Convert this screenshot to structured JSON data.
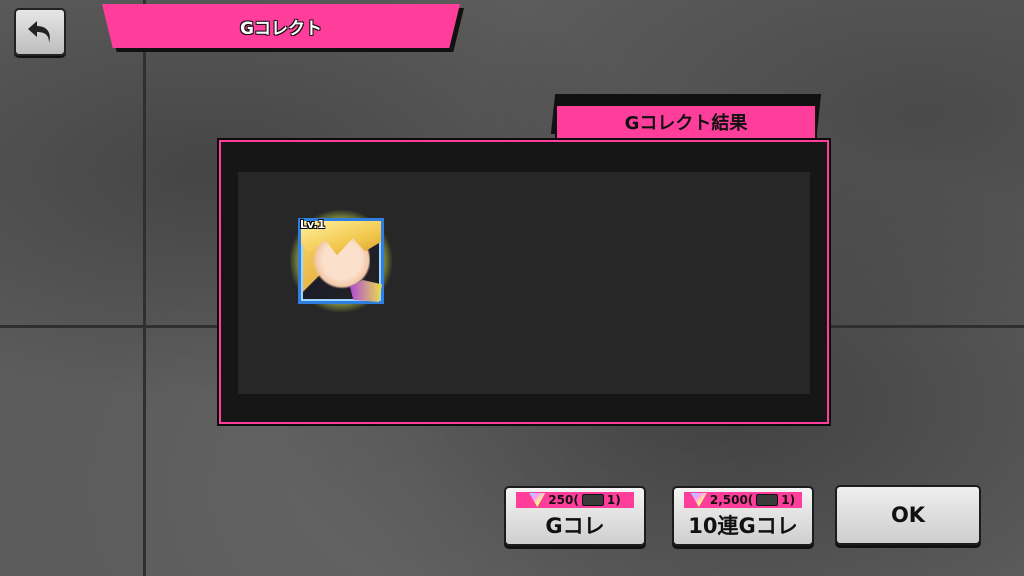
{
  "header": {
    "title": "Gコレクト"
  },
  "result": {
    "tab_label": "Gコレクト結果",
    "cards": [
      {
        "level": "Lv.1"
      }
    ]
  },
  "actions": {
    "single": {
      "cost": "250(",
      "ticket": "1)",
      "label": "Gコレ"
    },
    "ten": {
      "cost": "2,500(",
      "ticket": "1)",
      "label": "10連Gコレ"
    },
    "ok": {
      "label": "OK"
    }
  },
  "icons": [
    "back-arrow-icon",
    "gem-icon",
    "ticket-icon"
  ],
  "colors": {
    "accent": "#ff3d9b",
    "panel": "#161616",
    "button": "#e0e0e0"
  }
}
